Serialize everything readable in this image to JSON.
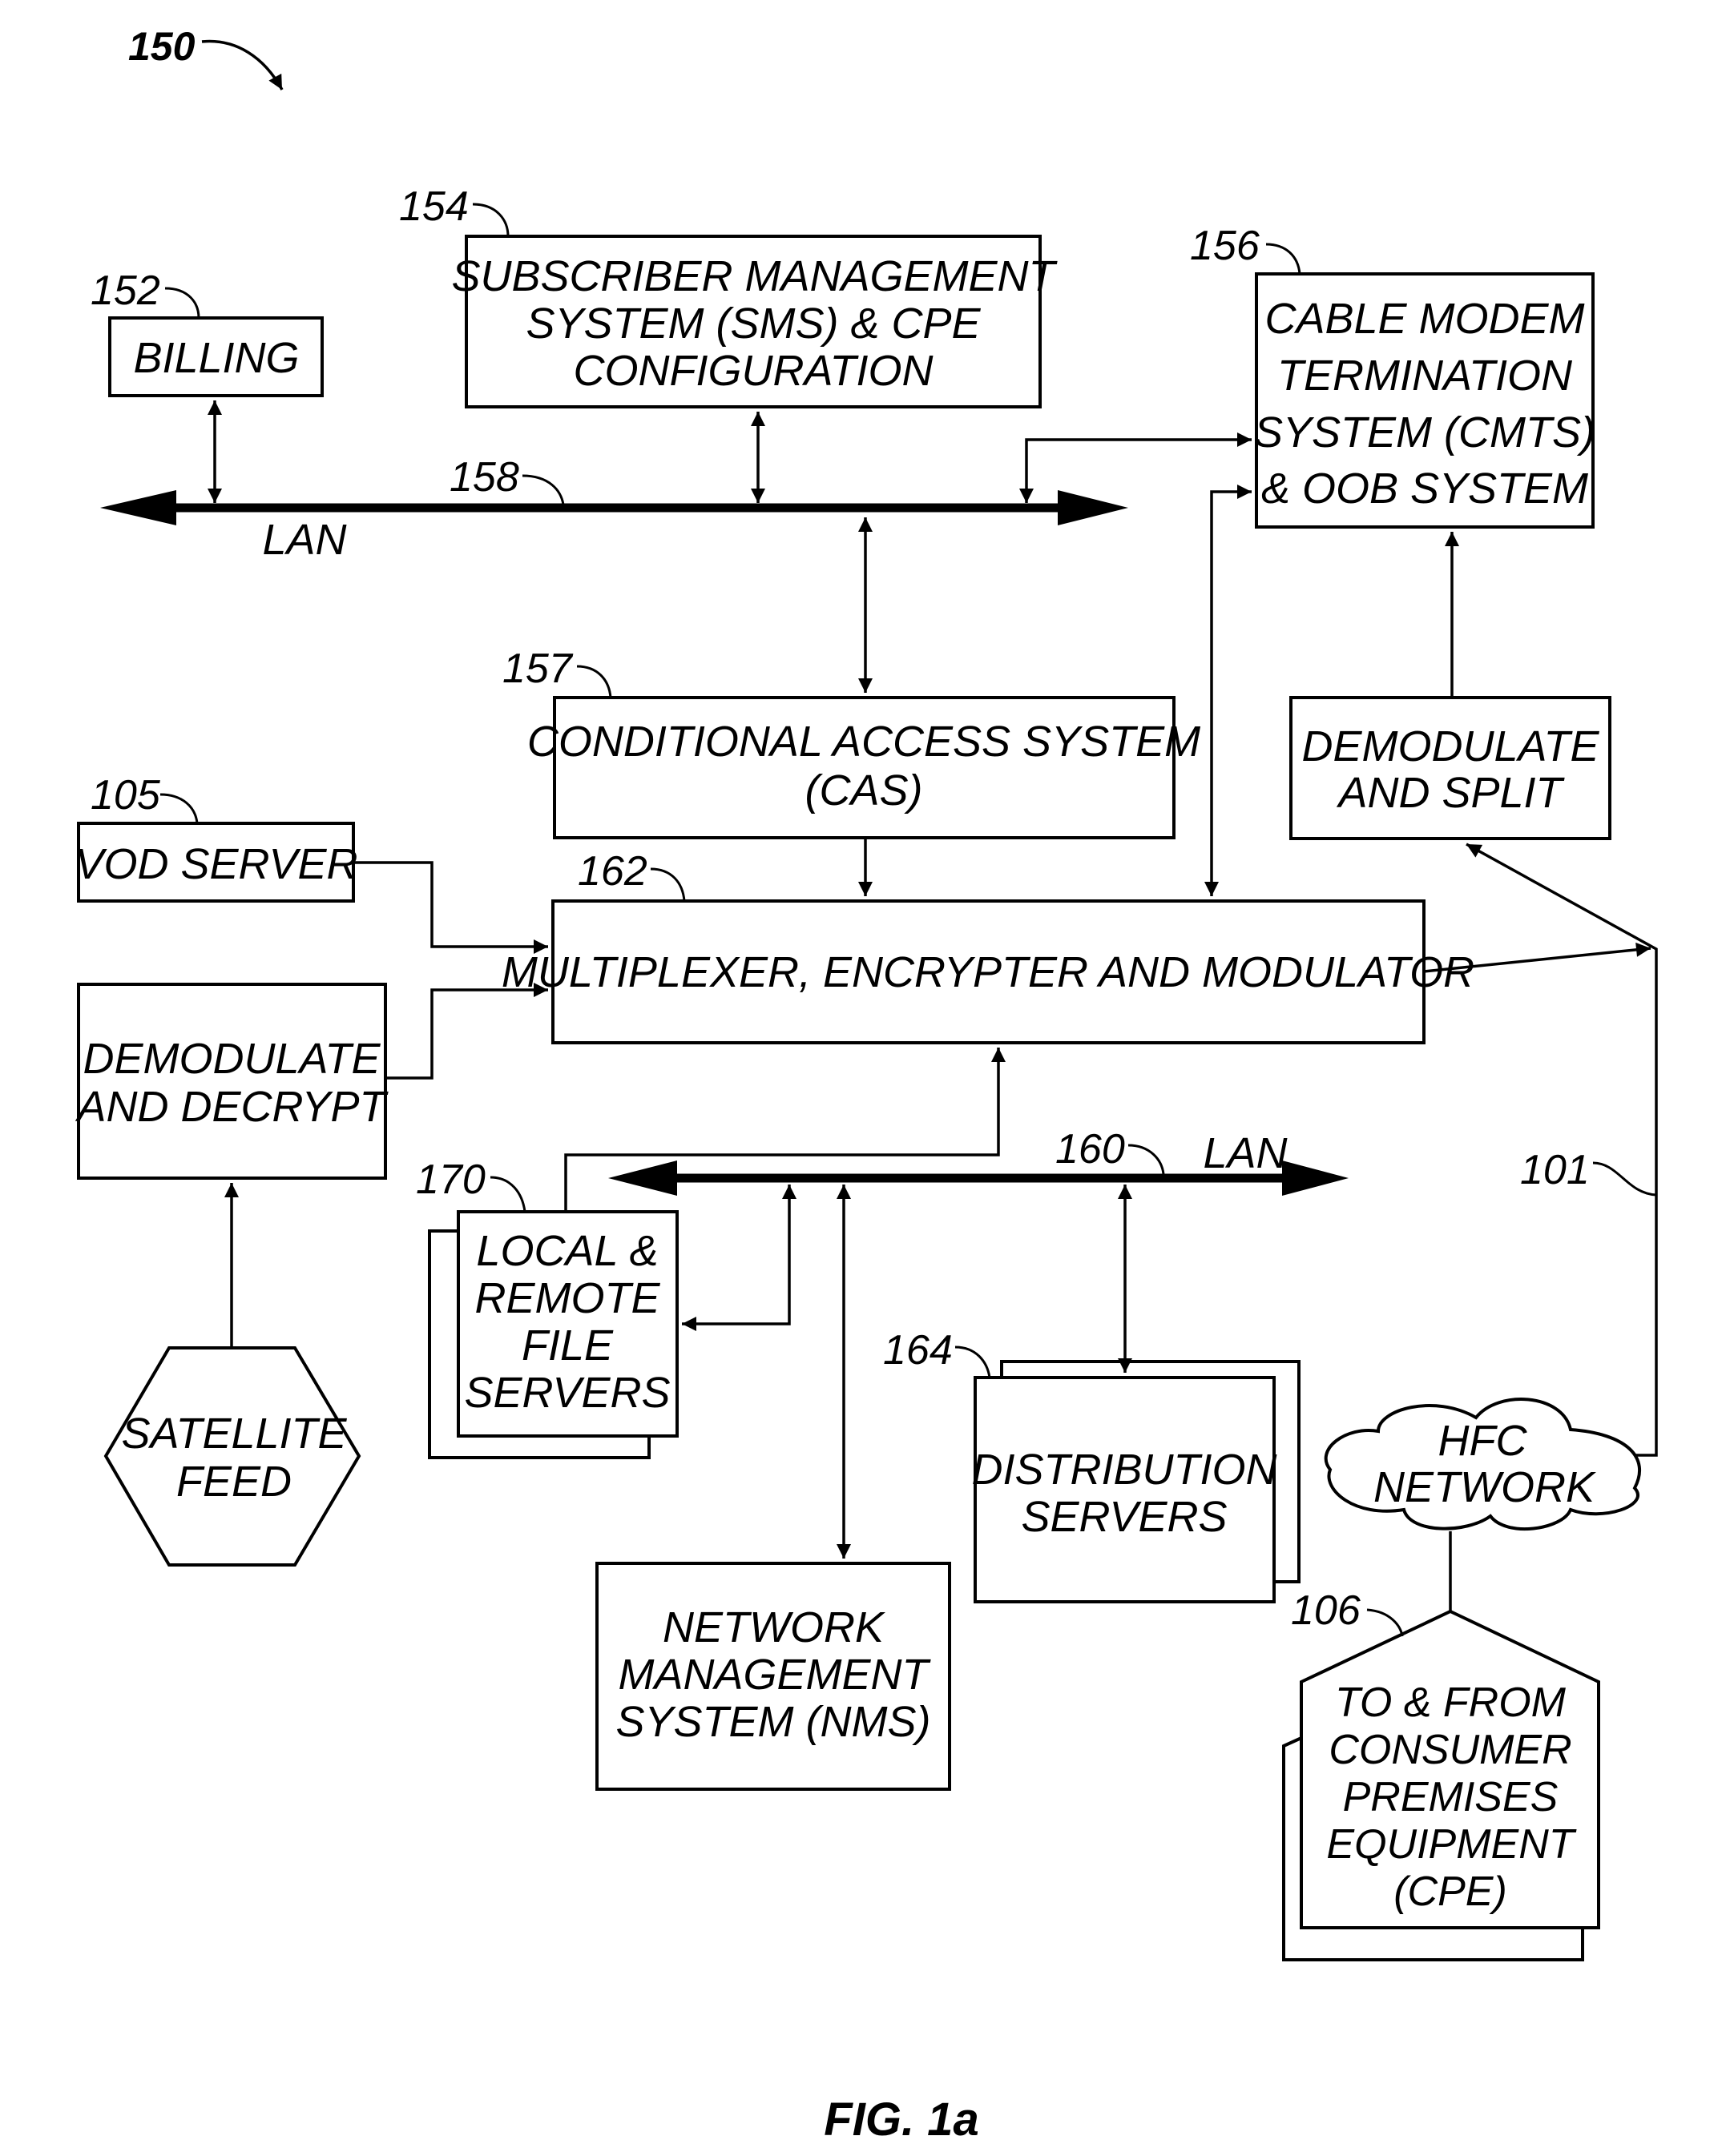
{
  "figure": {
    "reference": "150",
    "caption": "FIG. 1a"
  },
  "nodes": {
    "billing": {
      "ref": "152",
      "lines": [
        "BILLING"
      ]
    },
    "sms": {
      "ref": "154",
      "lines": [
        "SUBSCRIBER MANAGEMENT",
        "SYSTEM (SMS) & CPE",
        "CONFIGURATION"
      ]
    },
    "cmts": {
      "ref": "156",
      "lines": [
        "CABLE MODEM",
        "TERMINATION",
        "SYSTEM (CMTS)",
        "& OOB SYSTEM"
      ]
    },
    "cas": {
      "ref": "157",
      "lines": [
        "CONDITIONAL ACCESS SYSTEM",
        "(CAS)"
      ]
    },
    "demod_split": {
      "lines": [
        "DEMODULATE",
        "AND SPLIT"
      ]
    },
    "vod": {
      "ref": "105",
      "lines": [
        "VOD SERVER"
      ]
    },
    "mux": {
      "ref": "162",
      "lines": [
        "MULTIPLEXER, ENCRYPTER AND MODULATOR"
      ]
    },
    "demod_decrypt": {
      "lines": [
        "DEMODULATE",
        "AND DECRYPT"
      ]
    },
    "satellite": {
      "lines": [
        "SATELLITE",
        "FEED"
      ]
    },
    "file_servers": {
      "ref": "170",
      "lines": [
        "LOCAL &",
        "REMOTE",
        "FILE",
        "SERVERS"
      ]
    },
    "distribution": {
      "ref": "164",
      "lines": [
        "DISTRIBUTION",
        "SERVERS"
      ]
    },
    "nms": {
      "lines": [
        "NETWORK",
        "MANAGEMENT",
        "SYSTEM (NMS)"
      ]
    },
    "hfc": {
      "ref": "101",
      "lines": [
        "HFC",
        "NETWORK"
      ]
    },
    "cpe": {
      "ref": "106",
      "lines": [
        "TO & FROM",
        "CONSUMER",
        "PREMISES",
        "EQUIPMENT",
        "(CPE)"
      ]
    }
  },
  "buses": {
    "lan_top": {
      "ref": "158",
      "label": "LAN"
    },
    "lan_bottom": {
      "ref": "160",
      "label": "LAN"
    }
  }
}
